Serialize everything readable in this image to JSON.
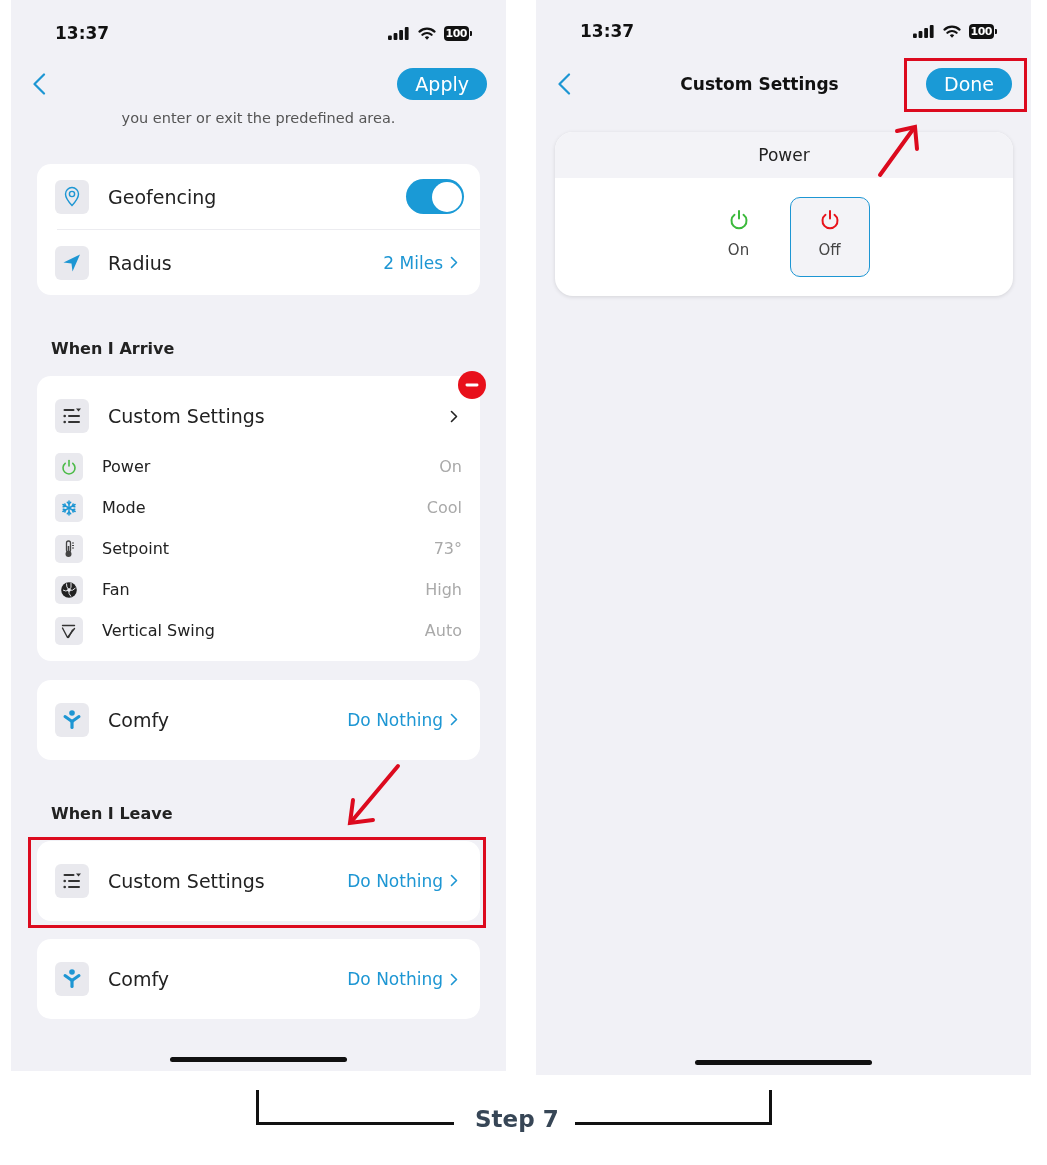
{
  "left_screen": {
    "status_bar": {
      "time": "13:37",
      "battery": "100"
    },
    "nav": {
      "button": "Apply",
      "highlighted": false
    },
    "intro": "you enter or exit the predefined area.",
    "settings_card": [
      {
        "kind": "geofence",
        "label": "Geofencing",
        "on": true
      },
      {
        "kind": "radius",
        "label": "Radius",
        "value": "2 Miles"
      }
    ],
    "sections": [
      {
        "heading": "When I Arrive",
        "actions": [
          {
            "kind": "custom_settings",
            "label": "Custom Settings",
            "delete_badge": true,
            "highlighted": false,
            "details": [
              {
                "kind": "power",
                "label": "Power",
                "value": "On"
              },
              {
                "kind": "mode",
                "label": "Mode",
                "value": "Cool"
              },
              {
                "kind": "setpoint",
                "label": "Setpoint",
                "value": "73°"
              },
              {
                "kind": "fan",
                "label": "Fan",
                "value": "High"
              },
              {
                "kind": "swing",
                "label": "Vertical Swing",
                "value": "Auto"
              }
            ]
          },
          {
            "kind": "comfy",
            "label": "Comfy",
            "value": "Do Nothing",
            "delete_badge": false,
            "highlighted": false
          }
        ]
      },
      {
        "heading": "When I Leave",
        "actions": [
          {
            "kind": "custom_settings",
            "label": "Custom Settings",
            "value": "Do Nothing",
            "delete_badge": false,
            "highlighted": true
          },
          {
            "kind": "comfy",
            "label": "Comfy",
            "value": "Do Nothing",
            "delete_badge": false,
            "highlighted": false
          }
        ]
      }
    ]
  },
  "right_screen": {
    "status_bar": {
      "time": "13:37",
      "battery": "100"
    },
    "nav": {
      "title": "Custom Settings",
      "button": "Done",
      "highlighted": true
    },
    "setting_card": {
      "title": "Power",
      "options": [
        {
          "label": "On",
          "color": "#3cb93c",
          "selected": false
        },
        {
          "label": "Off",
          "color": "#e8131b",
          "selected": true
        }
      ]
    }
  },
  "footer": {
    "label": "Step 7"
  }
}
